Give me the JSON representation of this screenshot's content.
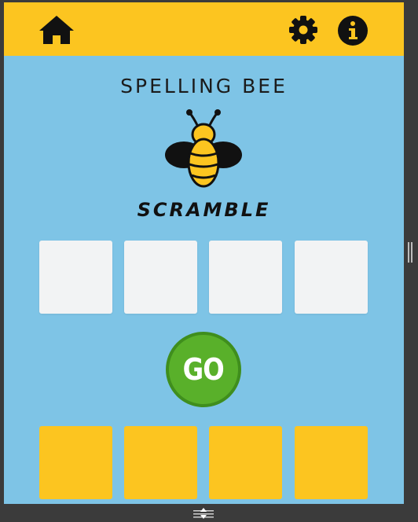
{
  "header": {
    "home_icon": "home-icon",
    "settings_icon": "gear-icon",
    "info_icon": "info-icon"
  },
  "main": {
    "title": "SPELLING BEE",
    "subtitle": "SCRAMBLE",
    "mascot_icon": "bee-icon",
    "answer_slots": [
      "",
      "",
      "",
      ""
    ],
    "letter_tiles": [
      "",
      "",
      "",
      ""
    ],
    "go_label": "GO"
  },
  "colors": {
    "background": "#7ec4e6",
    "header": "#fcc520",
    "tile": "#fcc520",
    "answer_slot": "#f2f3f4",
    "go_button": "#59b02a"
  }
}
